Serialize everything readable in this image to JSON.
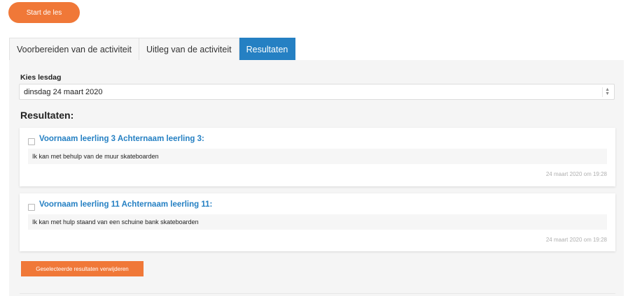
{
  "start_button": {
    "label": "Start de les"
  },
  "tabs": [
    {
      "label": "Voorbereiden van de activiteit",
      "active": false
    },
    {
      "label": "Uitleg van de activiteit",
      "active": false
    },
    {
      "label": "Resultaten",
      "active": true
    }
  ],
  "day_select": {
    "label": "Kies lesdag",
    "value": "dinsdag 24 maart 2020"
  },
  "results": {
    "title": "Resultaten:",
    "items": [
      {
        "name": "Voornaam leerling 3 Achternaam leerling 3:",
        "text": "Ik kan met behulp van de muur skateboarden",
        "timestamp": "24 maart 2020 om 19:28"
      },
      {
        "name": "Voornaam leerling 11 Achternaam leerling 11:",
        "text": "Ik kan met hulp staand van een schuine bank skateboarden",
        "timestamp": "24 maart 2020 om 19:28"
      }
    ],
    "delete_button": "Geselecteerde resultaten verwijderen"
  },
  "colors": {
    "accent_orange": "#f07838",
    "accent_blue": "#2580c3"
  }
}
